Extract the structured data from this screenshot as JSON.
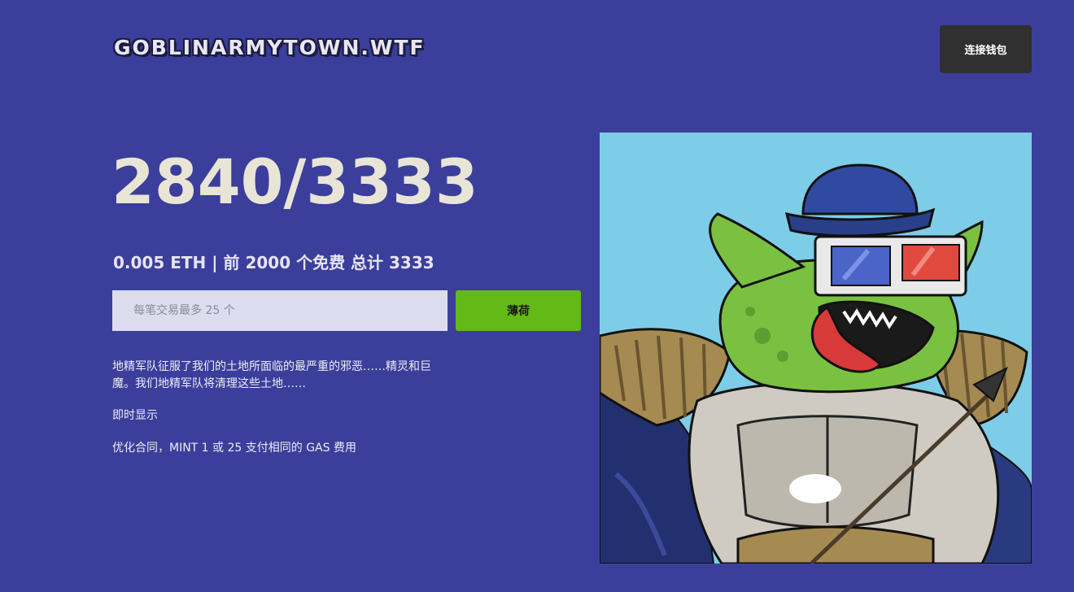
{
  "header": {
    "logo_text": "GOBLINARMYTOWN.WTF",
    "connect_label": "连接钱包"
  },
  "mint": {
    "counter": "2840/3333",
    "price_line": "0.005 ETH | 前 2000 个免费 总计 3333",
    "quantity_placeholder": "每笔交易最多 25 个",
    "quantity_value": "",
    "mint_label": "薄荷"
  },
  "description": {
    "paragraph_1": "地精军队征服了我们的土地所面临的最严重的邪恶……精灵和巨魔。我们地精军队将清理这些土地……",
    "paragraph_2": "即时显示",
    "paragraph_3": "优化合同，MINT 1 或 25 支付相同的 GAS 费用"
  },
  "colors": {
    "background": "#3b3f9b",
    "connect_button": "#2f302f",
    "mint_button": "#63b915",
    "input_background": "#dcdcee",
    "art_background": "#7dcde8"
  }
}
